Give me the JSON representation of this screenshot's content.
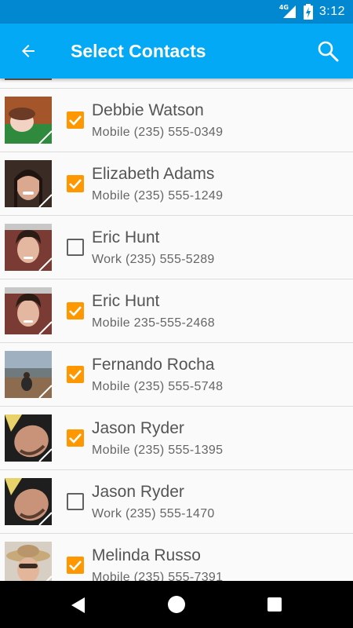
{
  "status_bar": {
    "network": "4G",
    "time": "3:12"
  },
  "app_bar": {
    "title": "Select Contacts",
    "back_icon": "arrow-back-icon",
    "search_icon": "search-icon"
  },
  "colors": {
    "status_bar": "#0288d1",
    "app_bar": "#03a9f4",
    "checkbox_checked": "#ff9800"
  },
  "contacts": [
    {
      "name": "Debbie Watson",
      "phone": "Mobile (235) 555-0349",
      "checked": true
    },
    {
      "name": "Elizabeth Adams",
      "phone": "Mobile (235) 555-1249",
      "checked": true
    },
    {
      "name": "Eric Hunt",
      "phone": "Work (235) 555-5289",
      "checked": false
    },
    {
      "name": "Eric Hunt",
      "phone": "Mobile 235-555-2468",
      "checked": true
    },
    {
      "name": "Fernando Rocha",
      "phone": "Mobile (235) 555-5748",
      "checked": true
    },
    {
      "name": "Jason Ryder",
      "phone": "Mobile (235) 555-1395",
      "checked": true
    },
    {
      "name": "Jason Ryder",
      "phone": "Work (235) 555-1470",
      "checked": false
    },
    {
      "name": "Melinda Russo",
      "phone": "Mobile (235) 555-7391",
      "checked": true
    }
  ],
  "nav_bar": {
    "back_icon": "nav-back-icon",
    "home_icon": "nav-home-icon",
    "recents_icon": "nav-recents-icon"
  }
}
